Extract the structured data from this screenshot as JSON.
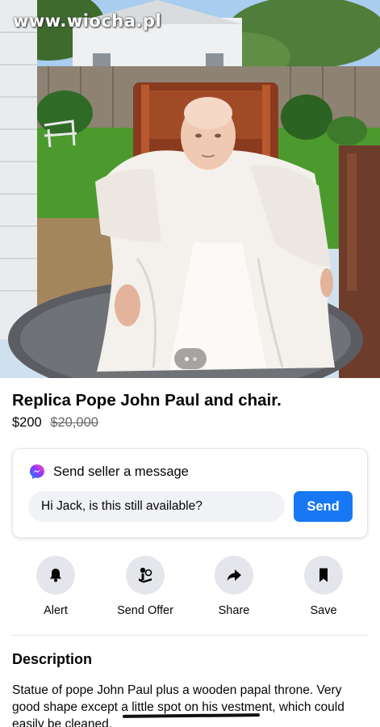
{
  "watermark": "www.wiocha.pl",
  "photo": {
    "carousel": {
      "total": 2,
      "active": 1
    }
  },
  "listing": {
    "title": "Replica Pope John Paul and chair.",
    "price": "$200",
    "original_price": "$20,000"
  },
  "message_card": {
    "title": "Send seller a message",
    "input_value": "Hi Jack, is this still available?",
    "send_label": "Send",
    "icon": "messenger-icon"
  },
  "actions": [
    {
      "label": "Alert",
      "icon": "bell-icon"
    },
    {
      "label": "Send Offer",
      "icon": "offer-icon"
    },
    {
      "label": "Share",
      "icon": "share-arrow-icon"
    },
    {
      "label": "Save",
      "icon": "bookmark-icon"
    }
  ],
  "description": {
    "heading": "Description",
    "text": "Statue of pope John Paul plus a wooden papal throne. Very good shape except a little spot on his vestment, which could easily be cleaned."
  },
  "colors": {
    "accent": "#1877f2",
    "button_bg": "#e4e6eb",
    "muted": "#65676b"
  }
}
